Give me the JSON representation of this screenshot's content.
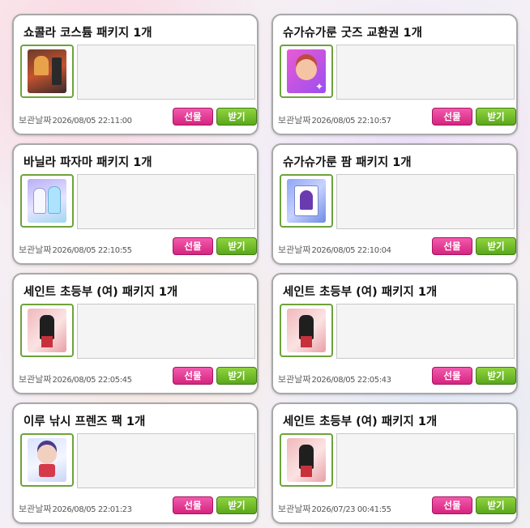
{
  "labels": {
    "date_label": "보관날짜",
    "gift_button": "선물",
    "receive_button": "받기"
  },
  "items": [
    {
      "title": "쇼콜라 코스튬 패키지 1개",
      "date": "2026/08/05 22:11:00",
      "icon": "chocolat-costume-icon"
    },
    {
      "title": "슈가슈가룬 굿즈 교환권 1개",
      "date": "2026/08/05 22:10:57",
      "icon": "sugar-goods-ticket-icon"
    },
    {
      "title": "바닐라 파자마 패키지 1개",
      "date": "2026/08/05 22:10:55",
      "icon": "vanilla-pajama-icon"
    },
    {
      "title": "슈가슈가룬 팜 패키지 1개",
      "date": "2026/08/05 22:10:04",
      "icon": "sugar-pajama-icon"
    },
    {
      "title": "세인트 초등부 (여) 패키지 1개",
      "date": "2026/08/05 22:05:45",
      "icon": "saint-uniform-icon"
    },
    {
      "title": "세인트 초등부 (여) 패키지 1개",
      "date": "2026/08/05 22:05:43",
      "icon": "saint-uniform-icon"
    },
    {
      "title": "이루 낚시 프렌즈 팩 1개",
      "date": "2026/08/05 22:01:23",
      "icon": "iru-fishing-friends-icon"
    },
    {
      "title": "세인트 초등부 (여) 패키지 1개",
      "date": "2026/07/23 00:41:55",
      "icon": "saint-uniform-icon"
    }
  ],
  "colors": {
    "gift_button": "#e03a95",
    "receive_button": "#6bb82a",
    "thumb_border": "#6da33b"
  }
}
